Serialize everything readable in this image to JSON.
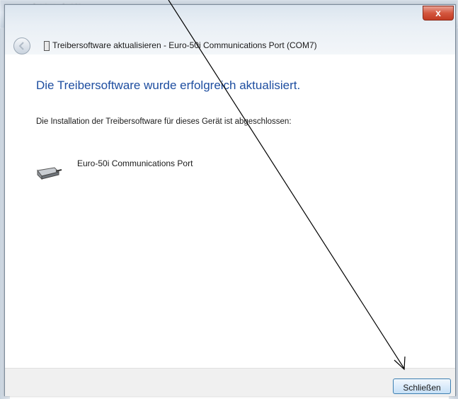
{
  "dialog": {
    "title": "Treibersoftware aktualisieren - Euro-50i Communications Port (COM7)",
    "close_glyph": "x",
    "heading": "Die Treibersoftware wurde erfolgreich aktualisiert.",
    "message": "Die Installation der Treibersoftware für dieses Gerät ist abgeschlossen:",
    "device_name": "Euro-50i Communications Port",
    "close_button_label": "Schließen"
  },
  "colors": {
    "heading": "#1e4ea0",
    "close_button_border": "#3c7fb1",
    "titlebar_close": "#c23a22"
  },
  "icons": [
    "back-arrow-icon",
    "device-small-icon",
    "serial-port-icon",
    "close-icon",
    "annotation-arrow"
  ]
}
